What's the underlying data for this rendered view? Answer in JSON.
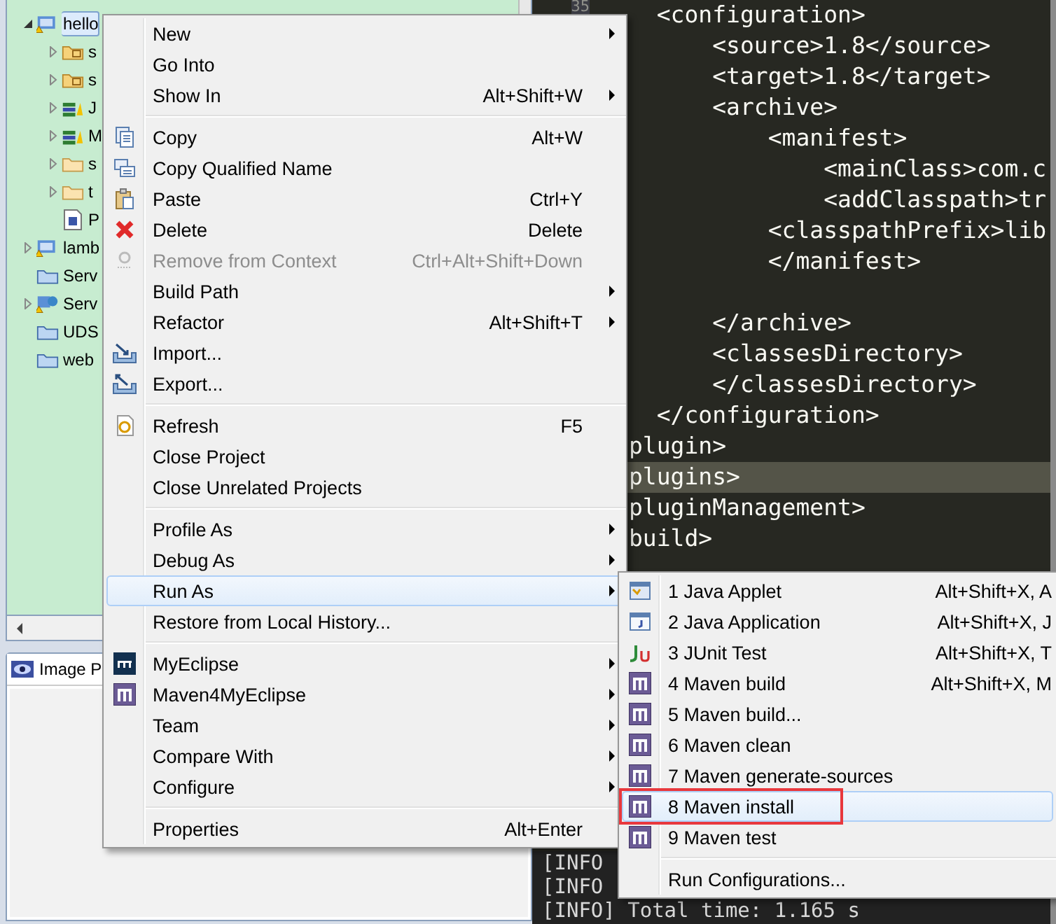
{
  "explorer": {
    "tree": [
      {
        "label": "hello",
        "selected": true,
        "expanded": true,
        "children": [
          {
            "label": "s",
            "selected": false,
            "expanded": false
          },
          {
            "label": "s",
            "selected": false,
            "expanded": false
          },
          {
            "label": "J",
            "selected": false,
            "expanded": false
          },
          {
            "label": "M",
            "selected": false,
            "expanded": false
          },
          {
            "label": "s",
            "selected": false,
            "expanded": false
          },
          {
            "label": "t",
            "selected": false,
            "expanded": false
          },
          {
            "label": "P",
            "selected": false
          }
        ]
      },
      {
        "label": "lamb",
        "selected": false,
        "expanded": false
      },
      {
        "label": "Serv",
        "selected": false
      },
      {
        "label": "Serv",
        "selected": false,
        "expanded": false
      },
      {
        "label": "UDS",
        "selected": false
      },
      {
        "label": "web",
        "selected": false
      }
    ]
  },
  "image_preview": {
    "tab": "Image P"
  },
  "editor": {
    "line_number": "35",
    "lines": [
      {
        "text": "  <configuration>",
        "current": false
      },
      {
        "text": "      <source>1.8</source>",
        "current": false
      },
      {
        "text": "      <target>1.8</target>",
        "current": false
      },
      {
        "text": "      <archive>",
        "current": false
      },
      {
        "text": "          <manifest>",
        "current": false
      },
      {
        "text": "              <mainClass>com.c",
        "current": false
      },
      {
        "text": "              <addClasspath>tr",
        "current": false
      },
      {
        "text": "          <classpathPrefix>lib",
        "current": false
      },
      {
        "text": "          </manifest>",
        "current": false
      },
      {
        "current": false
      },
      {
        "text": "      </archive>",
        "current": false
      },
      {
        "text": "      <classesDirectory>",
        "current": false
      },
      {
        "text": "      </classesDirectory>",
        "current": false
      },
      {
        "text": "  </configuration>",
        "current": false
      },
      {
        "text": "plugin>",
        "current": false
      },
      {
        "text": "plugins>",
        "current": true
      },
      {
        "text": "pluginManagement>",
        "current": false
      },
      {
        "text": "build>",
        "current": false
      }
    ]
  },
  "console": {
    "lines": [
      "[INFO",
      "[INFO",
      "[INFO] Total time: 1.165 s"
    ]
  },
  "context_menu": {
    "items": [
      {
        "kind": "item",
        "label": "New",
        "submenu": true,
        "selected": false
      },
      {
        "kind": "item",
        "label": "Go Into",
        "selected": false
      },
      {
        "kind": "item",
        "label": "Show In",
        "shortcut": "Alt+Shift+W",
        "submenu": true,
        "selected": false
      },
      {
        "kind": "separator"
      },
      {
        "kind": "item",
        "label": "Copy",
        "shortcut": "Alt+W",
        "selected": false
      },
      {
        "kind": "item",
        "label": "Copy Qualified Name",
        "selected": false
      },
      {
        "kind": "item",
        "label": "Paste",
        "shortcut": "Ctrl+Y",
        "selected": false
      },
      {
        "kind": "item",
        "label": "Delete",
        "shortcut": "Delete",
        "selected": false
      },
      {
        "kind": "item",
        "label": "Remove from Context",
        "shortcut": "Ctrl+Alt+Shift+Down",
        "disabled": true,
        "selected": false
      },
      {
        "kind": "item",
        "label": "Build Path",
        "submenu": true,
        "selected": false
      },
      {
        "kind": "item",
        "label": "Refactor",
        "shortcut": "Alt+Shift+T",
        "submenu": true,
        "selected": false
      },
      {
        "kind": "item",
        "label": "Import...",
        "selected": false
      },
      {
        "kind": "item",
        "label": "Export...",
        "selected": false
      },
      {
        "kind": "separator"
      },
      {
        "kind": "item",
        "label": "Refresh",
        "shortcut": "F5",
        "selected": false
      },
      {
        "kind": "item",
        "label": "Close Project",
        "selected": false
      },
      {
        "kind": "item",
        "label": "Close Unrelated Projects",
        "selected": false
      },
      {
        "kind": "separator"
      },
      {
        "kind": "item",
        "label": "Profile As",
        "submenu": true,
        "selected": false
      },
      {
        "kind": "item",
        "label": "Debug As",
        "submenu": true,
        "selected": false
      },
      {
        "kind": "item",
        "label": "Run As",
        "submenu": true,
        "selected": true
      },
      {
        "kind": "item",
        "label": "Restore from Local History...",
        "selected": false
      },
      {
        "kind": "separator"
      },
      {
        "kind": "item",
        "label": "MyEclipse",
        "submenu": true,
        "selected": false
      },
      {
        "kind": "item",
        "label": "Maven4MyEclipse",
        "submenu": true,
        "selected": false
      },
      {
        "kind": "item",
        "label": "Team",
        "submenu": true,
        "selected": false
      },
      {
        "kind": "item",
        "label": "Compare With",
        "submenu": true,
        "selected": false
      },
      {
        "kind": "item",
        "label": "Configure",
        "submenu": true,
        "selected": false
      },
      {
        "kind": "separator"
      },
      {
        "kind": "item",
        "label": "Properties",
        "shortcut": "Alt+Enter",
        "selected": false
      }
    ]
  },
  "run_as_submenu": {
    "items": [
      {
        "kind": "item",
        "label": "1 Java Applet",
        "shortcut": "Alt+Shift+X, A",
        "selected": false,
        "outlined": false
      },
      {
        "kind": "item",
        "label": "2 Java Application",
        "shortcut": "Alt+Shift+X, J",
        "selected": false,
        "outlined": false
      },
      {
        "kind": "item",
        "label": "3 JUnit Test",
        "shortcut": "Alt+Shift+X, T",
        "selected": false,
        "outlined": false
      },
      {
        "kind": "item",
        "label": "4 Maven build",
        "shortcut": "Alt+Shift+X, M",
        "selected": false,
        "outlined": false
      },
      {
        "kind": "item",
        "label": "5 Maven build...",
        "selected": false,
        "outlined": false
      },
      {
        "kind": "item",
        "label": "6 Maven clean",
        "selected": false,
        "outlined": false
      },
      {
        "kind": "item",
        "label": "7 Maven generate-sources",
        "selected": false,
        "outlined": false
      },
      {
        "kind": "item",
        "label": "8 Maven install",
        "selected": true,
        "outlined": true
      },
      {
        "kind": "item",
        "label": "9 Maven test",
        "selected": false,
        "outlined": false
      },
      {
        "kind": "separator"
      },
      {
        "kind": "item",
        "label": "Run Configurations...",
        "selected": false,
        "outlined": false
      }
    ]
  }
}
